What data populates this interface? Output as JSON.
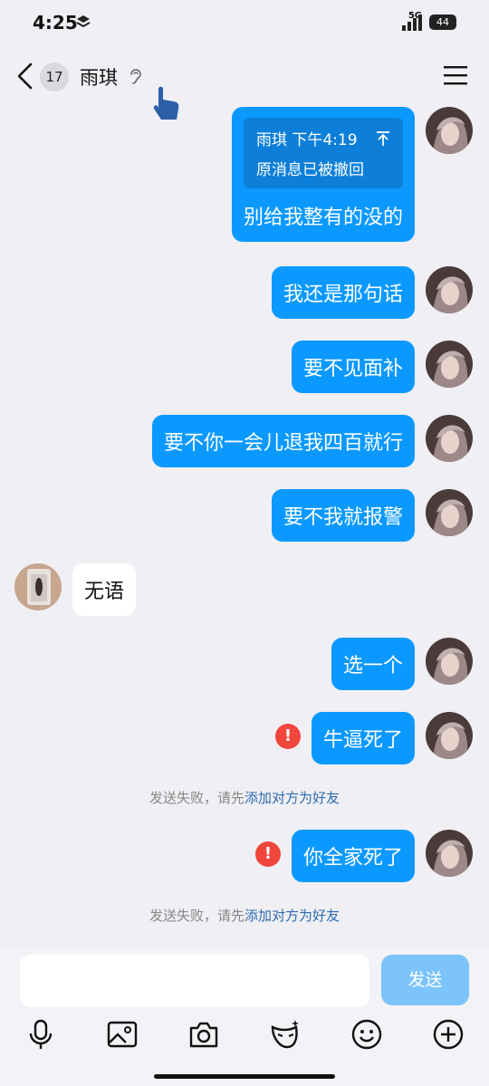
{
  "status": {
    "time": "4:25",
    "network": "5G",
    "battery": "44"
  },
  "header": {
    "badge": "17",
    "title": "雨琪"
  },
  "messages": [
    {
      "quote_name": "雨琪 下午4:19",
      "quote_text": "原消息已被撤回",
      "text": "别给我整有的没的"
    },
    {
      "text": "我还是那句话"
    },
    {
      "text": "要不见面补"
    },
    {
      "text": "要不你一会儿退我四百就行"
    },
    {
      "text": "要不我就报警"
    },
    {
      "text": "无语"
    },
    {
      "text": "选一个"
    },
    {
      "text": "牛逼死了"
    },
    {
      "text": "你全家死了"
    }
  ],
  "notice": {
    "prefix": "发送失败，请先",
    "link": "添加对方为好友"
  },
  "input": {
    "placeholder": "",
    "send_label": "发送"
  },
  "colors": {
    "outgoing": "#0b99ff",
    "incoming": "#ffffff",
    "error": "#f0463c",
    "link": "#2f6bb0",
    "send_disabled": "#7cc4fb"
  },
  "icons": [
    "back-icon",
    "ear-icon",
    "menu-icon",
    "microphone-icon",
    "image-icon",
    "camera-icon",
    "sticker-icon",
    "emoji-icon",
    "plus-icon"
  ]
}
